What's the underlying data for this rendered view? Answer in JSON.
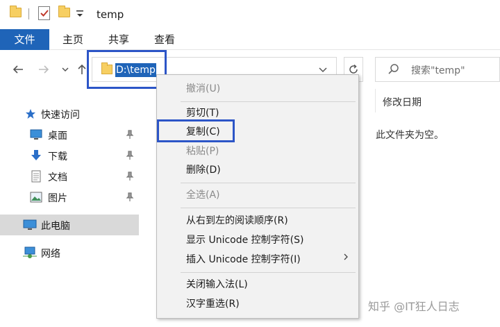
{
  "window": {
    "title": "temp"
  },
  "ribbon": {
    "tabs": [
      "文件",
      "主页",
      "共享",
      "查看"
    ]
  },
  "address": {
    "path": "D:\\temp"
  },
  "search": {
    "placeholder": "搜索\"temp\""
  },
  "sidebar": {
    "quick_access": "快速访问",
    "items": [
      {
        "label": "桌面",
        "icon": "desktop-icon",
        "pinned": true
      },
      {
        "label": "下载",
        "icon": "download-icon",
        "pinned": true
      },
      {
        "label": "文档",
        "icon": "document-icon",
        "pinned": true
      },
      {
        "label": "图片",
        "icon": "picture-icon",
        "pinned": true
      }
    ],
    "this_pc": "此电脑",
    "network": "网络"
  },
  "content": {
    "column_header": "修改日期",
    "empty_message": "此文件夹为空。"
  },
  "context_menu": {
    "items": [
      {
        "label": "撤消(U)",
        "disabled": true
      },
      {
        "label": "剪切(T)",
        "disabled": false
      },
      {
        "label": "复制(C)",
        "disabled": false,
        "highlighted": true
      },
      {
        "label": "粘贴(P)",
        "disabled": true
      },
      {
        "label": "删除(D)",
        "disabled": false
      },
      {
        "label": "全选(A)",
        "disabled": true
      },
      {
        "label": "从右到左的阅读顺序(R)",
        "disabled": false
      },
      {
        "label": "显示 Unicode 控制字符(S)",
        "disabled": false
      },
      {
        "label": "插入 Unicode 控制字符(I)",
        "disabled": false,
        "submenu": true
      },
      {
        "label": "关闭输入法(L)",
        "disabled": false
      },
      {
        "label": "汉字重选(R)",
        "disabled": false
      }
    ]
  },
  "watermark": "知乎 @IT狂人日志",
  "colors": {
    "accent": "#1f64b8",
    "highlight_box": "#2c55c7",
    "folder": "#f7cf62"
  }
}
